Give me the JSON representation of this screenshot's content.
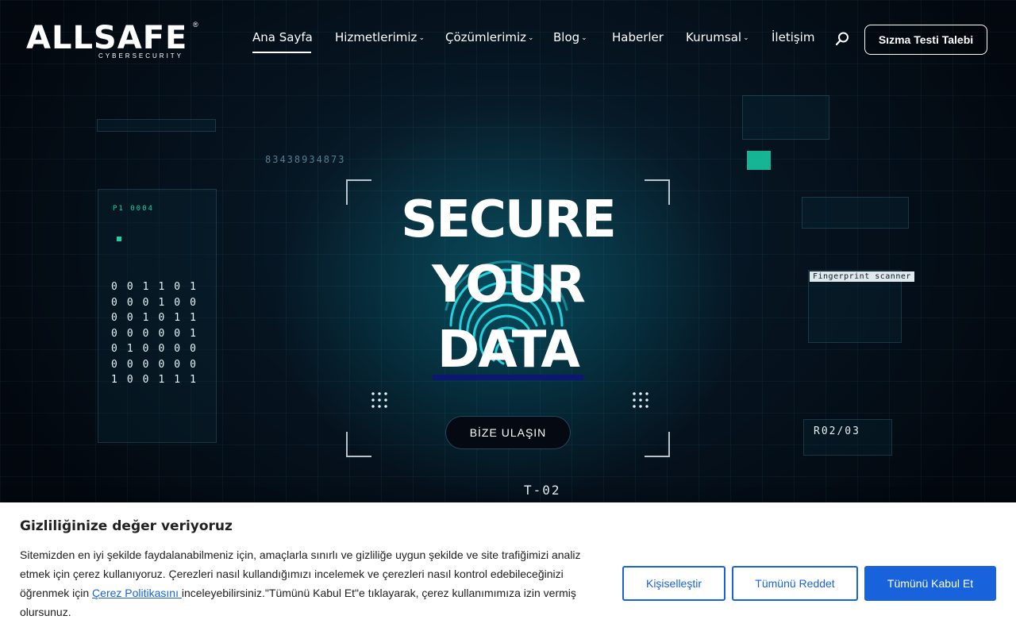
{
  "brand": {
    "name": "ALLSAFE",
    "registered": "®",
    "tagline": "CYBERSECURITY"
  },
  "nav": {
    "items": [
      {
        "label": "Ana Sayfa",
        "active": true,
        "dropdown": false
      },
      {
        "label": "Hizmetlerimiz",
        "dropdown": true
      },
      {
        "label": "Çözümlerimiz",
        "dropdown": true
      },
      {
        "label": "Blog",
        "dropdown": true
      },
      {
        "label": "Haberler",
        "dropdown": false
      },
      {
        "label": "Kurumsal",
        "dropdown": true
      },
      {
        "label": "İletişim",
        "dropdown": false
      }
    ],
    "dropdown_glyph": "⌄",
    "search_icon": "search-icon",
    "cta_label": "Sızma Testi Talebi"
  },
  "hero": {
    "headline_line1": "SECURE",
    "headline_line2": "YOUR",
    "headline_line3": "DATA",
    "button_label": "BİZE ULAŞIN",
    "accent_bar_color": "#0c1773",
    "deco": {
      "number_top": "83438934873",
      "code_right": "R02/03",
      "label_bottom": "T-02",
      "label_left": "P1 0004",
      "scanner_label": "Fingerprint scanner",
      "binary_rows": [
        "0 0 1 1 0 1",
        "0 0 0 1 0 0",
        "0 0 1 0 1 1",
        "0 0 0 0 0 1",
        "0 1 0 0 0 0",
        "0 0 0 0 0 0",
        "1 0 0 1 1 1"
      ]
    }
  },
  "cookie": {
    "title": "Gizliliğinize değer veriyoruz",
    "text_before_link": "Sitemizden en iyi şekilde faydalanabilmeniz için, amaçlarla sınırlı ve gizliliğe uygun şekilde ve site trafiğimizi analiz etmek için çerez kullanıyoruz. Çerezleri nasıl kullandığımızı incelemek ve çerezleri nasıl kontrol edebileceğinizi öğrenmek için ",
    "link_text": "Çerez Politikasını ",
    "text_after_link": "inceleyebilirsiniz.\"Tümünü Kabul Et\"e tıklayarak, çerez kullanımımıza izin vermiş olursunuz.",
    "btn_customize": "Kişiselleştir",
    "btn_reject": "Tümünü Reddet",
    "btn_accept": "Tümünü Kabul Et",
    "accent_color": "#1863dc"
  }
}
